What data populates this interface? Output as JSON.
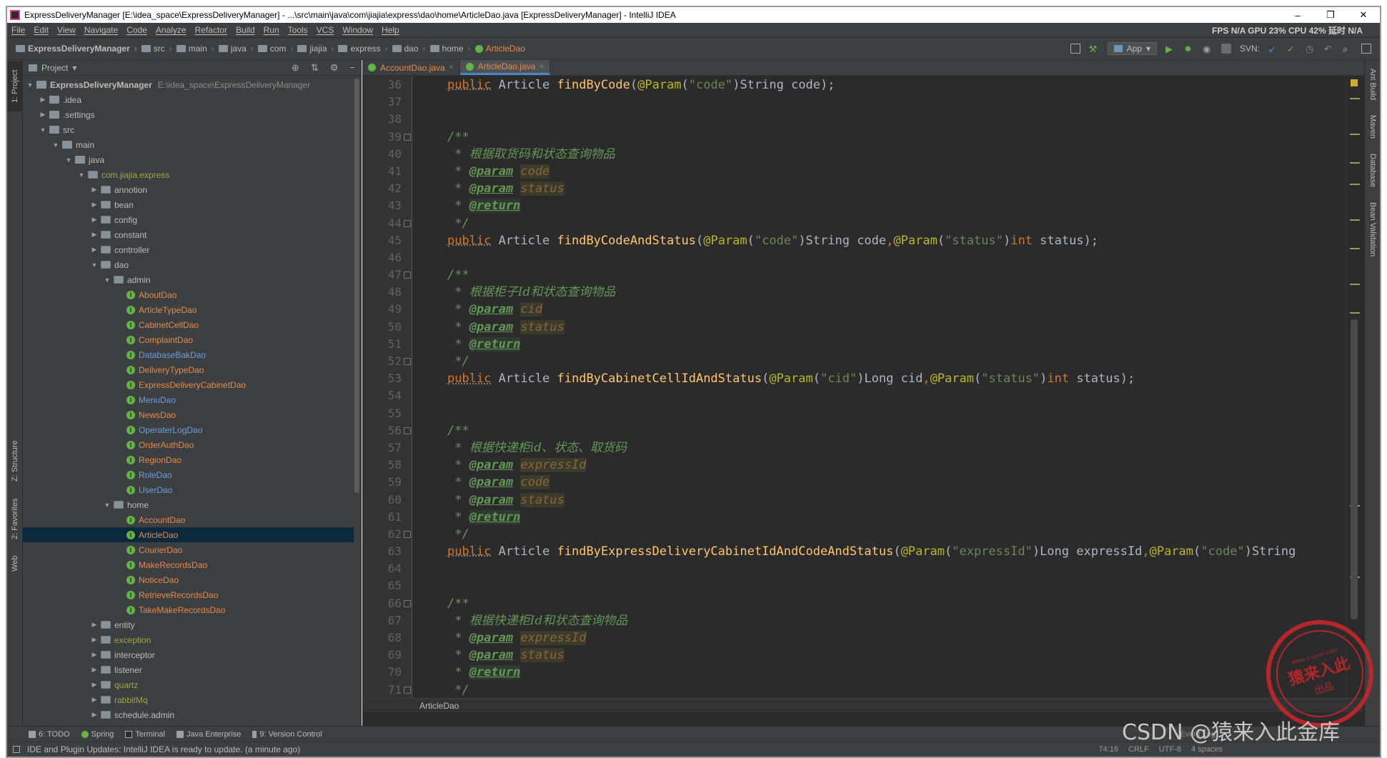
{
  "window": {
    "title": "ExpressDeliveryManager [E:\\idea_space\\ExpressDeliveryManager] - ...\\src\\main\\java\\com\\jiajia\\express\\dao\\home\\ArticleDao.java [ExpressDeliveryManager] - IntelliJ IDEA",
    "minimize": "–",
    "maximize": "❐",
    "close": "✕"
  },
  "menu": {
    "items": [
      "File",
      "Edit",
      "View",
      "Navigate",
      "Code",
      "Analyze",
      "Refactor",
      "Build",
      "Run",
      "Tools",
      "VCS",
      "Window",
      "Help"
    ],
    "perf": "FPS N/A GPU 23% CPU 42% 延时 N/A"
  },
  "navbar": {
    "crumbs": [
      "ExpressDeliveryManager",
      "src",
      "main",
      "java",
      "com",
      "jiajia",
      "express",
      "dao",
      "home",
      "ArticleDao"
    ],
    "run_config": "App",
    "svn_label": "SVN:"
  },
  "left_tabs": {
    "project": "1: Project",
    "structure": "Z: Structure",
    "favorites": "2: Favorites",
    "web": "Web"
  },
  "right_tabs": {
    "ant": "Ant Build",
    "maven": "Maven",
    "database": "Database",
    "bean": "Bean Validation"
  },
  "project_panel": {
    "header": "Project",
    "tree": [
      {
        "label": "ExpressDeliveryManager",
        "path": "E:\\idea_space\\ExpressDeliveryManager",
        "level": 0,
        "type": "module",
        "expanded": true
      },
      {
        "label": ".idea",
        "level": 1,
        "type": "folder",
        "expanded": false
      },
      {
        "label": ".settings",
        "level": 1,
        "type": "folder",
        "expanded": false
      },
      {
        "label": "src",
        "level": 1,
        "type": "folder",
        "expanded": true
      },
      {
        "label": "main",
        "level": 2,
        "type": "folder",
        "expanded": true
      },
      {
        "label": "java",
        "level": 3,
        "type": "folder",
        "expanded": true
      },
      {
        "label": "com.jiajia.express",
        "level": 4,
        "type": "package",
        "expanded": true,
        "color": "olive"
      },
      {
        "label": "annotion",
        "level": 5,
        "type": "package",
        "expanded": false
      },
      {
        "label": "bean",
        "level": 5,
        "type": "package",
        "expanded": false
      },
      {
        "label": "config",
        "level": 5,
        "type": "package",
        "expanded": false
      },
      {
        "label": "constant",
        "level": 5,
        "type": "package",
        "expanded": false
      },
      {
        "label": "controller",
        "level": 5,
        "type": "package",
        "expanded": false
      },
      {
        "label": "dao",
        "level": 5,
        "type": "package",
        "expanded": true
      },
      {
        "label": "admin",
        "level": 6,
        "type": "package",
        "expanded": true
      },
      {
        "label": "AboutDao",
        "level": 7,
        "type": "interface",
        "color": "orange"
      },
      {
        "label": "ArticleTypeDao",
        "level": 7,
        "type": "interface",
        "color": "orange"
      },
      {
        "label": "CabinetCellDao",
        "level": 7,
        "type": "interface",
        "color": "orange"
      },
      {
        "label": "ComplaintDao",
        "level": 7,
        "type": "interface",
        "color": "orange"
      },
      {
        "label": "DatabaseBakDao",
        "level": 7,
        "type": "interface",
        "color": "blue"
      },
      {
        "label": "DeliveryTypeDao",
        "level": 7,
        "type": "interface",
        "color": "orange"
      },
      {
        "label": "ExpressDeliveryCabinetDao",
        "level": 7,
        "type": "interface",
        "color": "orange"
      },
      {
        "label": "MenuDao",
        "level": 7,
        "type": "interface",
        "color": "blue"
      },
      {
        "label": "NewsDao",
        "level": 7,
        "type": "interface",
        "color": "orange"
      },
      {
        "label": "OperaterLogDao",
        "level": 7,
        "type": "interface",
        "color": "blue"
      },
      {
        "label": "OrderAuthDao",
        "level": 7,
        "type": "interface",
        "color": "orange"
      },
      {
        "label": "RegionDao",
        "level": 7,
        "type": "interface",
        "color": "orange"
      },
      {
        "label": "RoleDao",
        "level": 7,
        "type": "interface",
        "color": "blue"
      },
      {
        "label": "UserDao",
        "level": 7,
        "type": "interface",
        "color": "blue"
      },
      {
        "label": "home",
        "level": 6,
        "type": "package",
        "expanded": true
      },
      {
        "label": "AccountDao",
        "level": 7,
        "type": "interface",
        "color": "orange"
      },
      {
        "label": "ArticleDao",
        "level": 7,
        "type": "interface",
        "color": "orange",
        "selected": true
      },
      {
        "label": "CourierDao",
        "level": 7,
        "type": "interface",
        "color": "orange"
      },
      {
        "label": "MakeRecordsDao",
        "level": 7,
        "type": "interface",
        "color": "orange"
      },
      {
        "label": "NoticeDao",
        "level": 7,
        "type": "interface",
        "color": "orange"
      },
      {
        "label": "RetrieveRecordsDao",
        "level": 7,
        "type": "interface",
        "color": "orange"
      },
      {
        "label": "TakeMakeRecordsDao",
        "level": 7,
        "type": "interface",
        "color": "orange"
      },
      {
        "label": "entity",
        "level": 5,
        "type": "package",
        "expanded": false
      },
      {
        "label": "exception",
        "level": 5,
        "type": "package",
        "expanded": false,
        "color": "olive"
      },
      {
        "label": "interceptor",
        "level": 5,
        "type": "package",
        "expanded": false
      },
      {
        "label": "listener",
        "level": 5,
        "type": "package",
        "expanded": false
      },
      {
        "label": "quartz",
        "level": 5,
        "type": "package",
        "expanded": false,
        "color": "olive"
      },
      {
        "label": "rabbitMq",
        "level": 5,
        "type": "package",
        "expanded": false,
        "color": "olive"
      },
      {
        "label": "schedule.admin",
        "level": 5,
        "type": "package",
        "expanded": false
      }
    ]
  },
  "editor": {
    "tabs": [
      {
        "label": "AccountDao.java",
        "active": false
      },
      {
        "label": "ArticleDao.java",
        "active": true
      }
    ],
    "close_glyph": "×",
    "line_numbers": [
      "36",
      "37",
      "38",
      "39",
      "40",
      "41",
      "42",
      "43",
      "44",
      "45",
      "46",
      "47",
      "48",
      "49",
      "50",
      "51",
      "52",
      "53",
      "54",
      "55",
      "56",
      "57",
      "58",
      "59",
      "60",
      "61",
      "62",
      "63",
      "64",
      "65",
      "66",
      "67",
      "68",
      "69",
      "70",
      "71"
    ],
    "breadcrumb": "ArticleDao"
  },
  "code": {
    "l36_pub": "public",
    "l36_a": " Article ",
    "l36_fn": "findByCode",
    "l36_ann": "@Param",
    "l36_b": "(",
    "l36_str": "\"code\"",
    "l36_c": ")String code);",
    "doc_open": "/**",
    "doc_star": " * ",
    "doc_close": " */",
    "param_tag": "@param",
    "return_tag": "@return",
    "l40_text": "根据取货码和状态查询物品",
    "p_code": "code",
    "p_status": "status",
    "l45_pub": "public",
    "l45_a": " Article ",
    "l45_fn": "findByCodeAndStatus",
    "l45_ann1": "@Param",
    "l45_s1": "\"code\"",
    "l45_mid": ")String code",
    "l45_comma": ",",
    "l45_ann2": "@Param",
    "l45_s2": "\"status\"",
    "l45_int": "int",
    "l45_end": " status);",
    "l48_text": "根据柜子Id和状态查询物品",
    "p_cid": "cid",
    "l53_pub": "public",
    "l53_a": " Article ",
    "l53_fn": "findByCabinetCellIdAndStatus",
    "l53_ann1": "@Param",
    "l53_s1": "\"cid\"",
    "l53_mid": ")Long cid",
    "l53_comma": ",",
    "l53_ann2": "@Param",
    "l53_s2": "\"status\"",
    "l53_int": "int",
    "l53_end": " status);",
    "l57_text": "根据快递柜id、状态、取货码",
    "p_expressId": "expressId",
    "l63_pub": "public",
    "l63_a": " Article ",
    "l63_fn": "findByExpressDeliveryCabinetIdAndCodeAndStatus",
    "l63_ann1": "@Param",
    "l63_s1": "\"expressId\"",
    "l63_mid": ")Long expressId",
    "l63_comma": ",",
    "l63_ann2": "@Param",
    "l63_s2": "\"code\"",
    "l63_end": ")String",
    "l67_text": "根据快递柜Id和状态查询物品",
    "paren_open": "(",
    "paren_close": ")"
  },
  "bottom_bar": {
    "items": [
      "6: TODO",
      "Spring",
      "Terminal",
      "Java Enterprise",
      "9: Version Control"
    ],
    "event_log": "Event Log"
  },
  "status": {
    "message": "IDE and Plugin Updates: IntelliJ IDEA is ready to update. (a minute ago)",
    "position": "74:16",
    "line_sep": "CRLF",
    "encoding": "UTF-8",
    "indent": "4 spaces"
  },
  "watermark": {
    "csdn": "CSDN @猿来入此金库",
    "seal_url": "www.yuanrr.com",
    "seal_big": "猿来入此",
    "seal_small": "出品"
  },
  "colors": {
    "editor_bg": "#2b2b2b",
    "panel_bg": "#3c3f41",
    "keyword": "#cc7832",
    "function": "#ffc66d",
    "string": "#6a8759",
    "annotation": "#bbb529",
    "comment": "#629755",
    "selection": "#0d293e",
    "seal_red": "#c4262b"
  }
}
